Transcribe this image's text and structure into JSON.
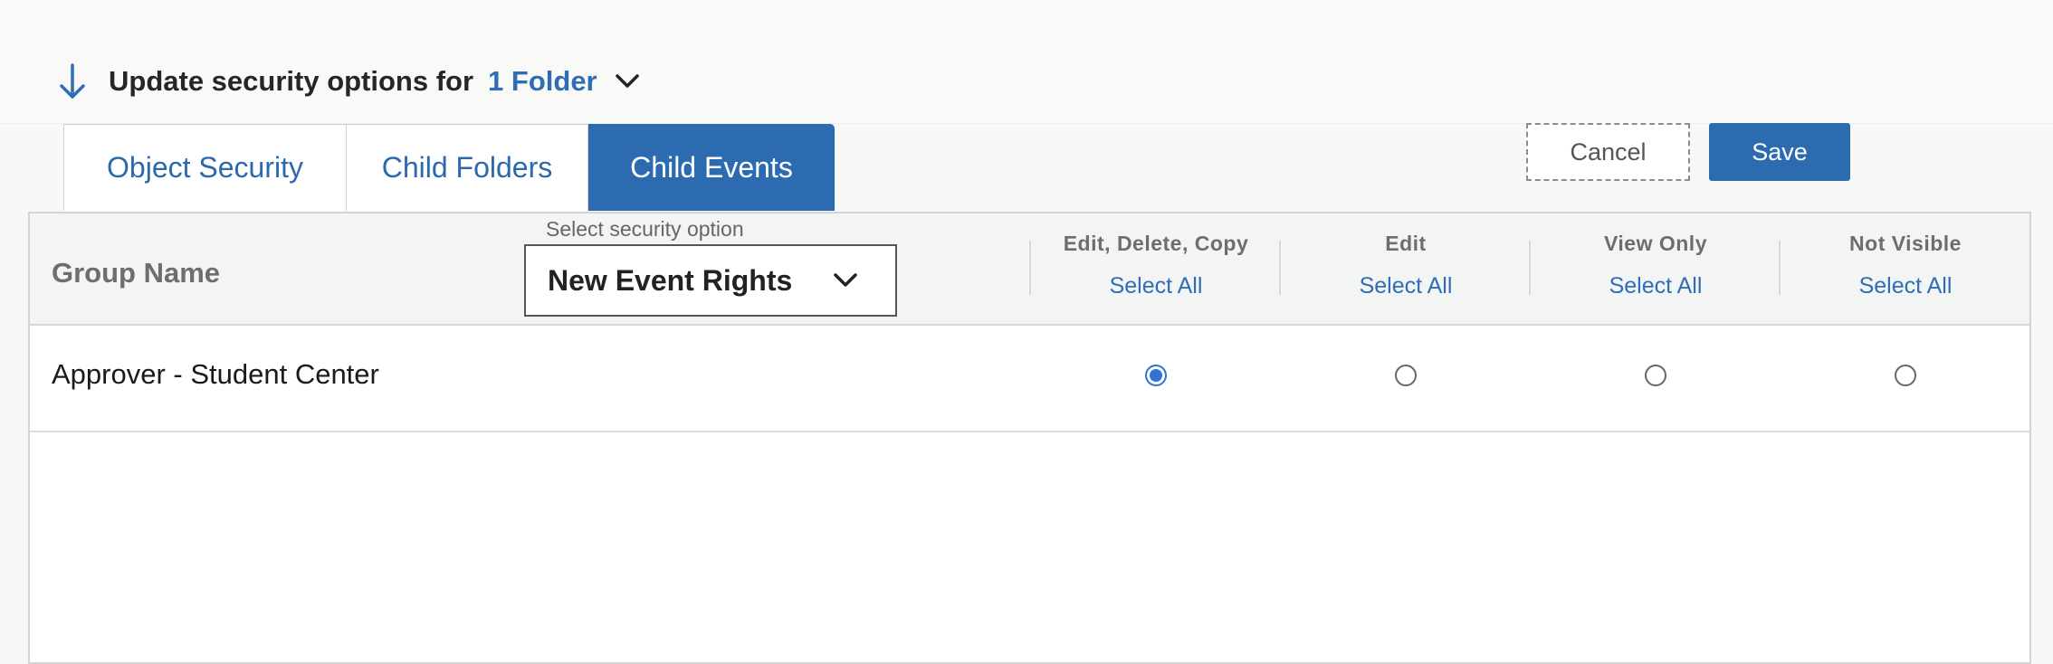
{
  "header": {
    "title": "Update security options for",
    "folder_link": "1 Folder"
  },
  "tabs": [
    {
      "label": "Object Security",
      "active": false
    },
    {
      "label": "Child Folders",
      "active": false
    },
    {
      "label": "Child Events",
      "active": true
    }
  ],
  "actions": {
    "cancel_label": "Cancel",
    "save_label": "Save"
  },
  "table": {
    "group_name_header": "Group Name",
    "security_select": {
      "label": "Select security option",
      "value": "New Event Rights"
    },
    "columns": [
      {
        "title": "Edit, Delete, Copy",
        "select_all": "Select All"
      },
      {
        "title": "Edit",
        "select_all": "Select All"
      },
      {
        "title": "View Only",
        "select_all": "Select All"
      },
      {
        "title": "Not Visible",
        "select_all": "Select All"
      }
    ],
    "rows": [
      {
        "name": "Approver - Student Center",
        "selected_column": 0
      }
    ]
  },
  "colors": {
    "accent": "#2c6bb0",
    "link": "#2f6eb5",
    "radio_checked": "#2f73d9"
  }
}
